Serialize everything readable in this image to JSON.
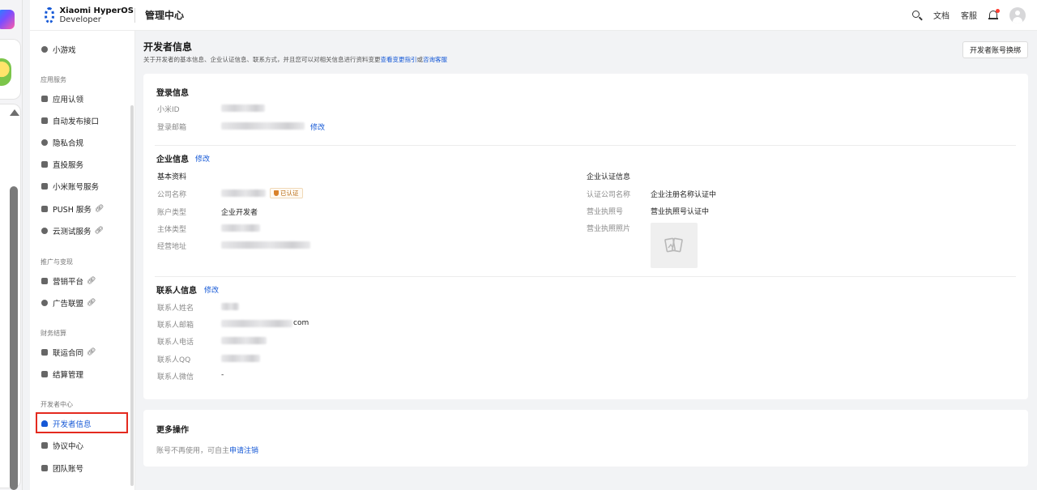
{
  "header": {
    "brand_line1": "Xiaomi HyperOS",
    "brand_line2": "Developer",
    "title": "管理中心",
    "docs_label": "文档",
    "support_label": "客服"
  },
  "sidebar": {
    "top_item": "小游戏",
    "groups": [
      {
        "label": "应用服务"
      },
      {
        "label": "推广与变现"
      },
      {
        "label": "财务结算"
      },
      {
        "label": "开发者中心"
      }
    ],
    "items": {
      "app_cert": "应用认领",
      "auto_publish": "自动发布接口",
      "privacy": "隐私合规",
      "direct_invest": "直投服务",
      "mi_account": "小米账号服务",
      "push": "PUSH 服务",
      "cloud_test": "云测试服务",
      "marketing": "营销平台",
      "ad_alliance": "广告联盟",
      "contract": "联运合同",
      "settlement": "结算管理",
      "dev_info": "开发者信息",
      "protocol": "协议中心",
      "team": "团队账号"
    }
  },
  "page": {
    "title": "开发者信息",
    "subtitle_prefix": "关于开发者的基本信息、企业认证信息、联系方式，并且您可以对相关信息进行资料变更",
    "subtitle_link1": "查看变更指引",
    "subtitle_mid": "或",
    "subtitle_link2": "咨询客服",
    "swap_button": "开发者账号换绑"
  },
  "login": {
    "title": "登录信息",
    "mi_id_label": "小米ID",
    "email_label": "登录邮箱",
    "edit": "修改"
  },
  "enterprise": {
    "title": "企业信息",
    "edit": "修改",
    "basic_head": "基本资料",
    "company_label": "公司名称",
    "verified_badge": "已认证",
    "account_type_label": "账户类型",
    "account_type_value": "企业开发者",
    "entity_type_label": "主体类型",
    "address_label": "经营地址",
    "cert_head": "企业认证信息",
    "cert_company_label": "认证公司名称",
    "cert_company_value": "企业注册名称认证中",
    "license_no_label": "营业执照号",
    "license_no_value": "营业执照号认证中",
    "license_photo_label": "营业执照照片"
  },
  "contact": {
    "title": "联系人信息",
    "edit": "修改",
    "name_label": "联系人姓名",
    "email_label": "联系人邮箱",
    "email_suffix": "com",
    "phone_label": "联系人电话",
    "qq_label": "联系人QQ",
    "wechat_label": "联系人微信",
    "wechat_value": "-"
  },
  "more": {
    "title": "更多操作",
    "text": "账号不再使用，可自主",
    "link": "申请注销"
  },
  "colors": {
    "accent": "#1558d6",
    "highlight_border": "#e42a1f",
    "verified": "#b86b12"
  }
}
